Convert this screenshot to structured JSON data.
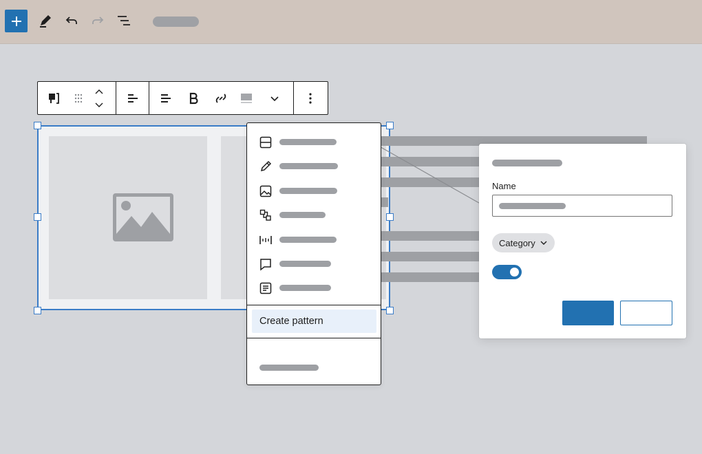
{
  "colors": {
    "accent": "#2271b1",
    "selection": "#3a7cc7",
    "topbar": "#d0c5bd",
    "canvas": "#d4d6da",
    "placeholder": "#9ea0a4"
  },
  "top_toolbar": {
    "items": [
      "add-block",
      "edit-pencil",
      "undo",
      "redo",
      "document-overview"
    ]
  },
  "block_toolbar": {
    "items": [
      "paragraph-transform",
      "drag-handle",
      "move-up-down",
      "align",
      "text-align",
      "bold",
      "link",
      "highlight",
      "more-chevron",
      "options-kebab"
    ]
  },
  "dropdown": {
    "items": [
      {
        "icon": "layout-icon"
      },
      {
        "icon": "pencil-icon"
      },
      {
        "icon": "image-icon"
      },
      {
        "icon": "transform-icon"
      },
      {
        "icon": "spacer-icon"
      },
      {
        "icon": "comment-icon"
      },
      {
        "icon": "post-content-icon"
      }
    ],
    "create_pattern": "Create pattern"
  },
  "modal": {
    "name_label": "Name",
    "category_label": "Category",
    "toggle_on": true
  }
}
